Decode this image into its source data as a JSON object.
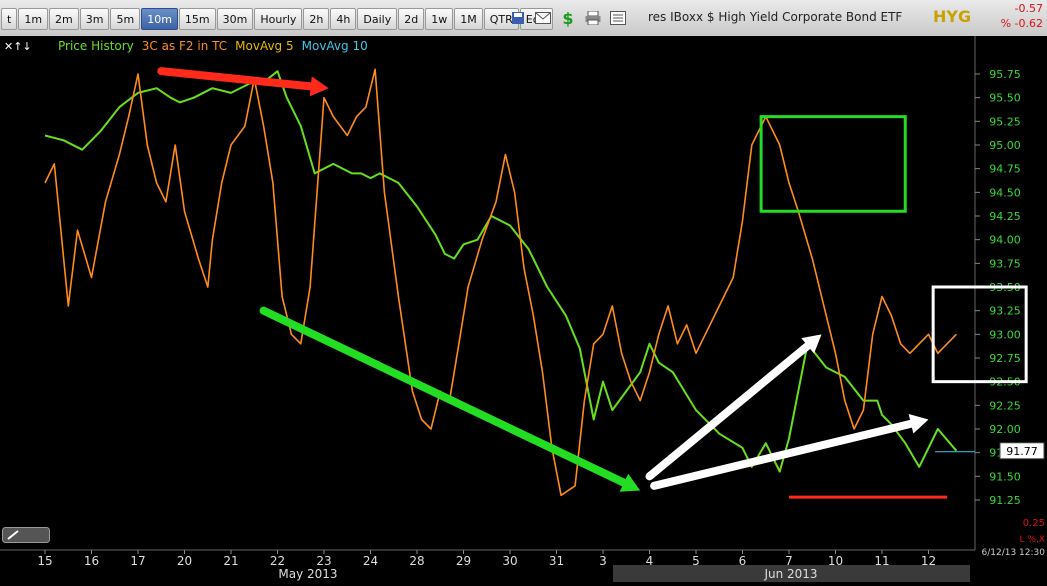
{
  "toolbar": {
    "timeframes": [
      "t",
      "1m",
      "2m",
      "3m",
      "5m",
      "10m",
      "15m",
      "30m",
      "Hourly",
      "2h",
      "4h",
      "Daily",
      "2d",
      "1w",
      "1M",
      "QTR",
      "Edit"
    ],
    "active_timeframe": "10m",
    "icons": [
      "save-icon",
      "mail-icon",
      "dollar-icon",
      "print-icon",
      "list-icon"
    ],
    "symbol_name": "res IBoxx $ High Yield Corporate Bond ETF",
    "ticker": "HYG",
    "change": "-0.57",
    "change_pct": "% -0.62"
  },
  "legend": {
    "items": [
      {
        "label": "Price History",
        "color": "#66e01c"
      },
      {
        "label": "3C as F2 in TC",
        "color": "#ff8c1a"
      },
      {
        "label": "MovAvg 5",
        "color": "#e6b800"
      },
      {
        "label": "MovAvg 10",
        "color": "#3ec8e8"
      }
    ]
  },
  "chart_data": {
    "type": "line",
    "title": "",
    "xlabel": "",
    "ylabel": "",
    "ylim": [
      91.25,
      95.75
    ],
    "y_ticks": [
      91.25,
      91.5,
      91.75,
      92,
      92.25,
      92.5,
      92.75,
      93,
      93.25,
      93.5,
      93.75,
      94,
      94.25,
      94.5,
      94.75,
      95,
      95.25,
      95.5,
      95.75
    ],
    "y_tick_labels": [
      "91.25",
      "91.50",
      "91.75",
      "92.00",
      "92.25",
      "92.50",
      "92.75",
      "93.00",
      "93.25",
      "93.50",
      "93.75",
      "94.00",
      "94.25",
      "94.50",
      "94.75",
      "95.00",
      "95.25",
      "95.50",
      "95.75"
    ],
    "x_ticks": [
      "15",
      "16",
      "17",
      "20",
      "21",
      "22",
      "23",
      "24",
      "28",
      "29",
      "30",
      "31",
      "3",
      "4",
      "5",
      "6",
      "7",
      "10",
      "11",
      "12"
    ],
    "months": [
      "May 2013",
      "Jun 2013"
    ],
    "last_price": "91.77",
    "last_date_label": "6/12/13 12:30",
    "right_axis_bottom": "0.25",
    "right_axis_corner": "L %,X",
    "series": [
      {
        "name": "Price History",
        "color": "#66e01c",
        "x": [
          0,
          0.4,
          0.8,
          1.2,
          1.6,
          2.0,
          2.4,
          2.7,
          2.9,
          3.2,
          3.6,
          4.0,
          4.4,
          4.8,
          5.0,
          5.2,
          5.5,
          5.8,
          6.2,
          6.6,
          6.8,
          7.0,
          7.2,
          7.6,
          8.0,
          8.4,
          8.6,
          8.8,
          9.0,
          9.3,
          9.6,
          10.0,
          10.4,
          10.8,
          11.2,
          11.5,
          11.8,
          12.0,
          12.2,
          12.5,
          12.8,
          13.0,
          13.2,
          13.5,
          14.0,
          14.5,
          15.0,
          15.2,
          15.5,
          15.8,
          16.0,
          16.4,
          16.8,
          17.2,
          17.6,
          17.9,
          18.0,
          18.2,
          18.5,
          18.8,
          19.2,
          19.6
        ],
        "values": [
          95.1,
          95.05,
          94.95,
          95.15,
          95.4,
          95.55,
          95.6,
          95.5,
          95.45,
          95.5,
          95.6,
          95.55,
          95.65,
          95.7,
          95.78,
          95.5,
          95.2,
          94.7,
          94.8,
          94.7,
          94.7,
          94.65,
          94.7,
          94.6,
          94.35,
          94.05,
          93.85,
          93.8,
          93.95,
          94.0,
          94.25,
          94.15,
          93.9,
          93.5,
          93.2,
          92.85,
          92.1,
          92.5,
          92.2,
          92.4,
          92.6,
          92.9,
          92.7,
          92.6,
          92.2,
          91.95,
          91.8,
          91.6,
          91.85,
          91.55,
          91.9,
          92.9,
          92.65,
          92.55,
          92.3,
          92.3,
          92.15,
          92.05,
          91.85,
          91.6,
          92.0,
          91.77
        ]
      },
      {
        "name": "3C as F2 in TC",
        "color": "#ff8c1a",
        "x": [
          0,
          0.2,
          0.3,
          0.5,
          0.7,
          1.0,
          1.3,
          1.6,
          1.8,
          2.0,
          2.2,
          2.4,
          2.6,
          2.8,
          3.0,
          3.3,
          3.5,
          3.6,
          3.8,
          4.0,
          4.3,
          4.5,
          4.7,
          4.9,
          5.1,
          5.3,
          5.5,
          5.7,
          6.0,
          6.2,
          6.5,
          6.7,
          6.9,
          7.1,
          7.3,
          7.6,
          7.9,
          8.1,
          8.3,
          8.5,
          8.7,
          8.9,
          9.1,
          9.4,
          9.7,
          9.9,
          10.1,
          10.3,
          10.5,
          10.7,
          10.9,
          11.1,
          11.4,
          11.6,
          11.8,
          12.0,
          12.2,
          12.4,
          12.6,
          12.8,
          13.0,
          13.2,
          13.4,
          13.6,
          13.8,
          14.0,
          14.2,
          14.4,
          14.6,
          14.8,
          15.0,
          15.2,
          15.5,
          15.8,
          16.0,
          16.2,
          16.5,
          16.8,
          17.0,
          17.2,
          17.4,
          17.6,
          17.8,
          18.0,
          18.2,
          18.4,
          18.6,
          18.8,
          19.0,
          19.2,
          19.4,
          19.6
        ],
        "values": [
          94.6,
          94.8,
          94.3,
          93.3,
          94.1,
          93.6,
          94.4,
          94.9,
          95.3,
          95.75,
          95.0,
          94.6,
          94.4,
          95.0,
          94.3,
          93.8,
          93.5,
          94.0,
          94.6,
          95.0,
          95.2,
          95.7,
          95.2,
          94.6,
          93.4,
          93.0,
          92.9,
          93.5,
          95.5,
          95.3,
          95.1,
          95.3,
          95.4,
          95.8,
          94.5,
          93.4,
          92.4,
          92.1,
          92.0,
          92.4,
          92.3,
          92.9,
          93.5,
          94.0,
          94.4,
          94.9,
          94.5,
          93.7,
          93.2,
          92.6,
          91.8,
          91.3,
          91.4,
          92.3,
          92.9,
          93.0,
          93.3,
          92.8,
          92.5,
          92.3,
          92.6,
          93.0,
          93.3,
          92.9,
          93.1,
          92.8,
          93.0,
          93.2,
          93.4,
          93.6,
          94.2,
          95.0,
          95.3,
          95.0,
          94.6,
          94.3,
          93.8,
          93.2,
          92.8,
          92.3,
          92.0,
          92.2,
          93.0,
          93.4,
          93.2,
          92.9,
          92.8,
          92.9,
          93.0,
          92.8,
          92.9,
          93.0
        ]
      }
    ],
    "annotations": [
      {
        "type": "arrow",
        "color": "#ff2a1a",
        "from": [
          2.5,
          95.78
        ],
        "to": [
          6.1,
          95.6
        ]
      },
      {
        "type": "arrow",
        "color": "#22dd22",
        "from": [
          4.7,
          93.25
        ],
        "to": [
          12.8,
          91.35
        ]
      },
      {
        "type": "arrow",
        "color": "#ffffff",
        "from": [
          13.0,
          91.5
        ],
        "to": [
          16.7,
          93.0
        ]
      },
      {
        "type": "arrow",
        "color": "#ffffff",
        "from": [
          13.1,
          91.4
        ],
        "to": [
          19.0,
          92.1
        ]
      },
      {
        "type": "box",
        "color": "#22dd22",
        "x0": 15.4,
        "x1": 18.5,
        "y0": 94.3,
        "y1": 95.3
      },
      {
        "type": "box",
        "color": "#ffffff",
        "x0": 19.1,
        "x1": 21.1,
        "y0": 92.5,
        "y1": 93.5
      },
      {
        "type": "line",
        "color": "#ff2a1a",
        "x0": 16.0,
        "x1": 19.4,
        "y": 91.28
      }
    ]
  }
}
